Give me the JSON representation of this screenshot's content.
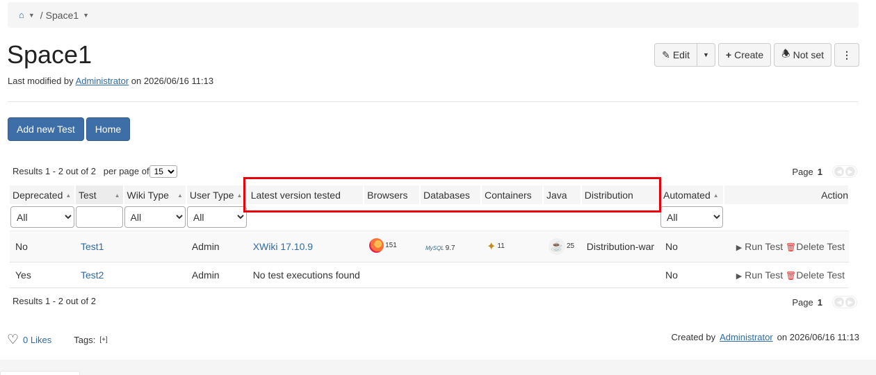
{
  "breadcrumb": {
    "home_icon": "home-icon",
    "space": "Space1",
    "separator": "/"
  },
  "page": {
    "title": "Space1",
    "modified_prefix": "Last modified by",
    "modified_user": "Administrator",
    "modified_suffix": "on 2026/06/16 11:13"
  },
  "actions": {
    "edit": "Edit",
    "create": "Create",
    "notify": "Not set"
  },
  "buttons": {
    "add_test": "Add new Test",
    "home": "Home"
  },
  "results_top": {
    "text": "Results 1 - 2 out of 2",
    "per_page_label": "per page of",
    "per_page_value": "15"
  },
  "results_bottom": {
    "text": "Results 1 - 2 out of 2"
  },
  "pager": {
    "label": "Page",
    "current": "1"
  },
  "columns": {
    "deprecated": "Deprecated",
    "test": "Test",
    "wiki_type": "Wiki Type",
    "user_type": "User Type",
    "latest_version": "Latest version tested",
    "browsers": "Browsers",
    "databases": "Databases",
    "containers": "Containers",
    "java": "Java",
    "distribution": "Distribution",
    "automated": "Automated",
    "action": "Action"
  },
  "filters": {
    "all": "All"
  },
  "rows": [
    {
      "deprecated": "No",
      "test": "Test1",
      "wiki_type": "",
      "user_type": "Admin",
      "latest_version": "XWiki 17.10.9",
      "browsers": "151",
      "databases": "9.7",
      "containers": "11",
      "java": "25",
      "distribution": "Distribution-war",
      "automated": "No",
      "run": "Run Test",
      "delete": "Delete Test"
    },
    {
      "deprecated": "Yes",
      "test": "Test2",
      "wiki_type": "",
      "user_type": "Admin",
      "latest_version": "No test executions found",
      "automated": "No",
      "run": "Run Test",
      "delete": "Delete Test"
    }
  ],
  "icons": {
    "mysql_text": "MySQL"
  },
  "footer": {
    "likes": "0 Likes",
    "tags_label": "Tags:",
    "tags_add": "[+]",
    "created_prefix": "Created by",
    "created_user": "Administrator",
    "created_suffix": "on 2026/06/16 11:13"
  },
  "colors": {
    "primary": "#3e6ea8",
    "link": "#2e6aa3",
    "highlight": "#e8000b"
  }
}
